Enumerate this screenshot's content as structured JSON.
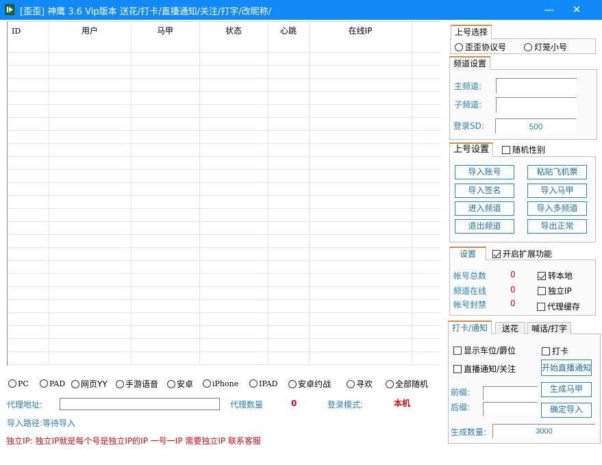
{
  "window": {
    "title": "[歪歪] 神鹰 3.6 Vip版本 送花/打卡/直播通知/关注/打字/改昵称/",
    "icon": "app-play-icon",
    "minimize": "—",
    "close": "✕"
  },
  "table": {
    "columns": [
      "ID",
      "用户",
      "马甲",
      "状态",
      "心跳",
      "在线IP",
      ""
    ],
    "rows": []
  },
  "platforms": {
    "selected": null,
    "options": [
      {
        "label": "PC"
      },
      {
        "label": "PAD"
      },
      {
        "label": "网页YY"
      },
      {
        "label": "手游语音"
      },
      {
        "label": "安卓"
      },
      {
        "label": "iPhone"
      },
      {
        "label": "IPAD"
      },
      {
        "label": "安卓约战"
      },
      {
        "label": "寻欢"
      },
      {
        "label": "全部随机"
      }
    ]
  },
  "proxy": {
    "address_label": "代理地址:",
    "address_value": "",
    "count_label": "代理数量",
    "count_value": "0",
    "login_mode_label": "登录模式:",
    "login_mode_value": "本机"
  },
  "import_path": "导入路径:等待导入",
  "notice": "独立IP: 独立IP就是每个号是独立IP的IP 一号一IP 需要独立IP 联系客服",
  "account_select": {
    "tab": "上号选择",
    "options": [
      {
        "label": "歪歪协议号",
        "selected": false
      },
      {
        "label": "灯笼小号",
        "selected": false
      }
    ]
  },
  "channel_settings": {
    "tab": "频道设置",
    "main_channel_label": "主频道:",
    "main_channel_value": "",
    "sub_channel_label": "子频道:",
    "sub_channel_value": "",
    "login_sd_label": "登录SD:",
    "login_sd_value": "500"
  },
  "login_settings": {
    "tab": "上号设置",
    "random_gender_label": "随机性别",
    "random_gender_checked": false,
    "buttons": [
      "导入账号",
      "粘贴飞机票",
      "导入签名",
      "导入马甲",
      "进入频道",
      "导入多频道",
      "退出频道",
      "导出正常"
    ]
  },
  "settings": {
    "tab": "设置",
    "extend_label": "开启扩展功能",
    "extend_checked": true,
    "stats": [
      {
        "label": "帐号总数",
        "value": "0"
      },
      {
        "label": "频道在线",
        "value": "0"
      },
      {
        "label": "帐号封禁",
        "value": "0"
      }
    ],
    "options": [
      {
        "label": "转本地",
        "checked": true
      },
      {
        "label": "独立IP",
        "checked": false
      },
      {
        "label": "代理缓存",
        "checked": false
      }
    ]
  },
  "action_tabs": {
    "tabs": [
      "打卡/通知",
      "送花",
      "喊话/打字"
    ],
    "active": "打卡/通知",
    "show_seat_label": "显示车位/爵位",
    "show_seat_checked": false,
    "checkin_label": "打卡",
    "checkin_checked": false,
    "live_notify_label": "直播通知/关注",
    "live_notify_checked": false,
    "start_live_notify": "开始直播通知",
    "prefix_label": "前缀:",
    "prefix_value": "",
    "suffix_label": "后缀:",
    "suffix_value": "",
    "generate_vest": "生成马甲",
    "confirm_import": "确定导入",
    "gen_count_label": "生成数量:",
    "gen_count_value": "3000"
  }
}
